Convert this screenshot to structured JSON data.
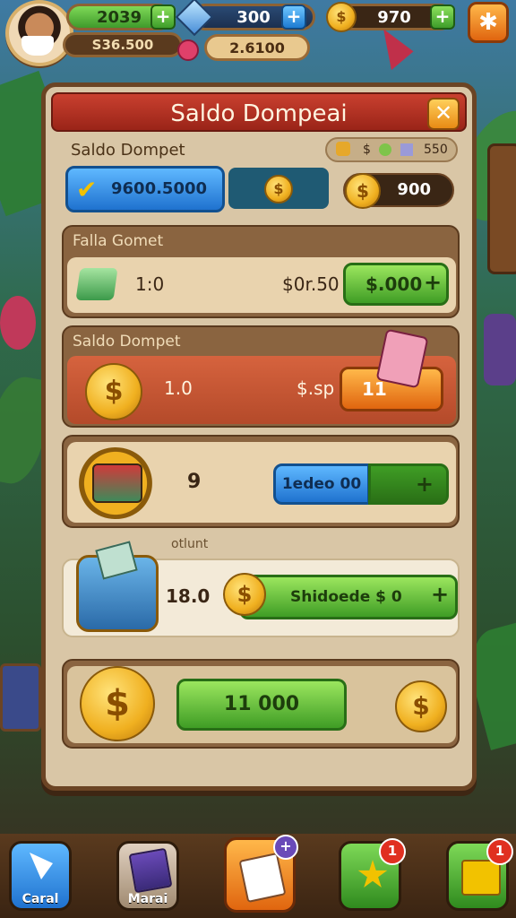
{
  "top": {
    "coins_value": "2039",
    "gems_value": "300",
    "gold_value": "970",
    "player_balance": "S36.500",
    "event_value": "2.6100"
  },
  "panel": {
    "title": "Saldo Dompeai",
    "subheader_label": "Saldo Dompet",
    "subheader_currency_1": "$",
    "subheader_value": "550",
    "wallet_blue_value": "9600.5000",
    "wallet_gold_value": "900"
  },
  "section1": {
    "label": "Falla Gomet",
    "amount": "1:0",
    "price": "$0r.50",
    "button_value": "$.000"
  },
  "section2": {
    "label": "Saldo Dompet",
    "amount": "1.0",
    "price": "$.sp",
    "button_value": "11"
  },
  "section3": {
    "amount": "9",
    "button_value": "1edeo 00"
  },
  "section4": {
    "tag": "otlunt",
    "amount": "18.0",
    "button_value": "Shidoede $ 0"
  },
  "section5": {
    "button_value": "11 000"
  },
  "bottom_nav": {
    "tab1_label": "Caral",
    "tab2_label": "Marai",
    "badge1": "1",
    "badge2": "1"
  }
}
